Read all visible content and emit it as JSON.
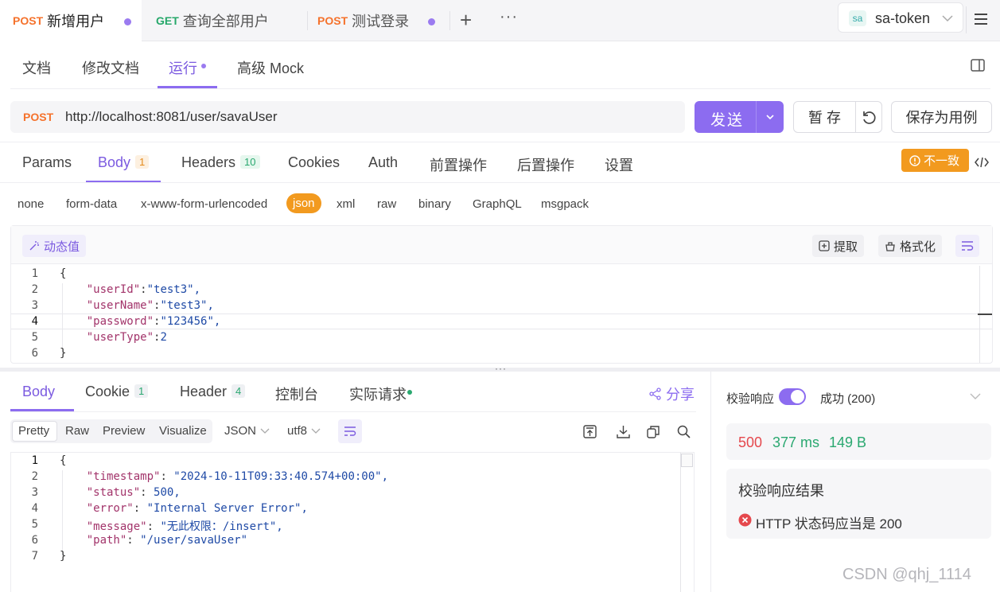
{
  "tabs": [
    {
      "method": "POST",
      "name": "新增用户"
    },
    {
      "method": "GET",
      "name": "查询全部用户"
    },
    {
      "method": "POST",
      "name": "测试登录"
    }
  ],
  "env": {
    "badge": "sa",
    "name": "sa-token"
  },
  "doc_tabs": [
    "文档",
    "修改文档",
    "运行",
    "高级 Mock"
  ],
  "request": {
    "method": "POST",
    "url": "http://localhost:8081/user/savaUser",
    "send_label": "发送",
    "save_label": "暂 存",
    "save_case_label": "保存为用例"
  },
  "param_tabs": [
    {
      "label": "Params"
    },
    {
      "label": "Body",
      "count": "1"
    },
    {
      "label": "Headers",
      "count": "10"
    },
    {
      "label": "Cookies"
    },
    {
      "label": "Auth"
    },
    {
      "label": "前置操作"
    },
    {
      "label": "后置操作"
    },
    {
      "label": "设置"
    }
  ],
  "mismatch_label": "不一致",
  "body_types": [
    "none",
    "form-data",
    "x-www-form-urlencoded",
    "json",
    "xml",
    "raw",
    "binary",
    "GraphQL",
    "msgpack"
  ],
  "editor": {
    "dynamic_label": "动态值",
    "extract_label": "提取",
    "format_label": "格式化",
    "lines": [
      "{",
      "    \"userId\":\"test3\",",
      "    \"userName\":\"test3\",",
      "    \"password\":\"123456\",",
      "    \"userType\":2",
      "}"
    ]
  },
  "response_tabs": [
    {
      "label": "Body"
    },
    {
      "label": "Cookie",
      "count": "1"
    },
    {
      "label": "Header",
      "count": "4"
    },
    {
      "label": "控制台"
    },
    {
      "label": "实际请求"
    }
  ],
  "share_label": "分享",
  "view_modes": [
    "Pretty",
    "Raw",
    "Preview",
    "Visualize"
  ],
  "format_select": "JSON",
  "encoding_select": "utf8",
  "response_lines": [
    "{",
    "    \"timestamp\": \"2024-10-11T09:33:40.574+00:00\",",
    "    \"status\": 500,",
    "    \"error\": \"Internal Server Error\",",
    "    \"message\": \"无此权限：/insert\",",
    "    \"path\": \"/user/savaUser\"",
    "}"
  ],
  "validate": {
    "label": "校验响应",
    "result_status": "成功 (200)",
    "status_code": "500",
    "time": "377 ms",
    "size": "149 B",
    "result_title": "校验响应结果",
    "result_message": "HTTP 状态码应当是 200"
  },
  "watermark": "CSDN @qhj_1114",
  "colors": {
    "accent": "#8c6cf0",
    "post": "#f5722c",
    "get": "#26a86a",
    "warn": "#f29a1f",
    "error": "#e5484d"
  }
}
